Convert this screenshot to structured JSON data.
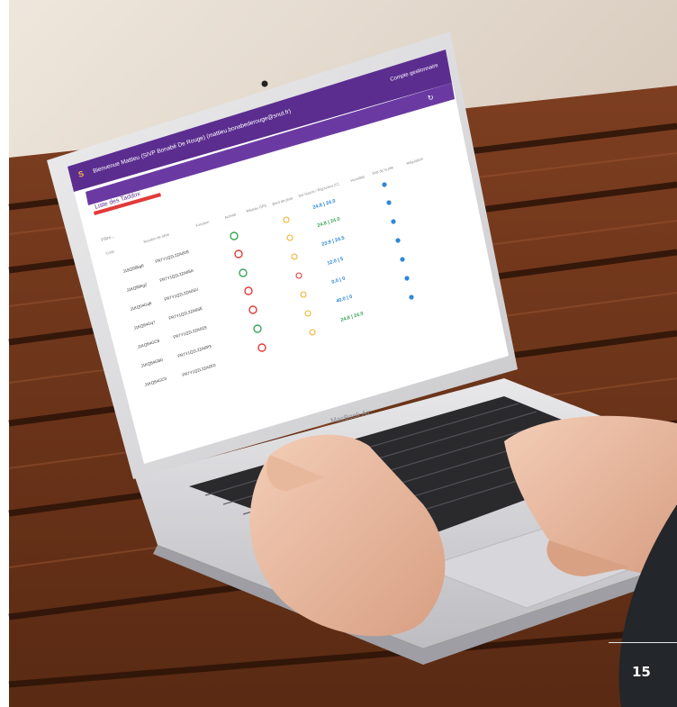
{
  "screen": {
    "app_bar_title": "Bienvenue Mattieu (SIVP Bonabé De Rouge) (mattieu.bonabederouge@snut.fr)",
    "app_bar_right_link": "Compte gestionnaire",
    "section_title": "Liste des Taddox",
    "filter_placeholder": "Filtre...",
    "columns": [
      "Code",
      "Numéro de série",
      "Fonction",
      "Activité",
      "Réseau GPS",
      "Bord de pluie",
      "Sol Gazon / Rigoureux (C)",
      "Humidité",
      "Etat de la pile",
      "Régulation"
    ],
    "rows": [
      {
        "code": "J19QSBkg6",
        "serial": "FR7Y1Q2L2ZA00S",
        "status": "ok",
        "reading": "24.8 | 24.0"
      },
      {
        "code": "J1KQ80kg2",
        "serial": "FR7Y1Q2L2ZA85A",
        "status": "error",
        "reading": "24.8 | 24.0"
      },
      {
        "code": "J1KQ04Gq6",
        "serial": "FR7Y1Q2L2ZA0SV",
        "status": "ok",
        "reading": "23.9 | 24.5"
      },
      {
        "code": "J1KQ84Gq7",
        "serial": "FR7Y1Q2L2ZA8SE",
        "status": "error",
        "reading": "12.0 | 5"
      },
      {
        "code": "J1KQ84GC8",
        "serial": "FR7Y1Q2L2ZA0Z9",
        "status": "error",
        "reading": "0.0 | 0"
      },
      {
        "code": "J1KQ84GB0",
        "serial": "FR7Y1Q2L2ZA6P3",
        "status": "ok",
        "reading": "40.0 | 0"
      },
      {
        "code": "J1KQ84GC0",
        "serial": "FR7Y1Q2L2ZA5F0",
        "status": "error",
        "reading": "24.8 | 24.0"
      }
    ]
  },
  "laptop_brand": "MacBook Air",
  "page_number": "15",
  "colors": {
    "app_bar": "#5b2d8f",
    "accent": "#e23a3a",
    "ok": "#3aa65a",
    "water": "#2f88d8",
    "sun": "#f2b02f"
  }
}
